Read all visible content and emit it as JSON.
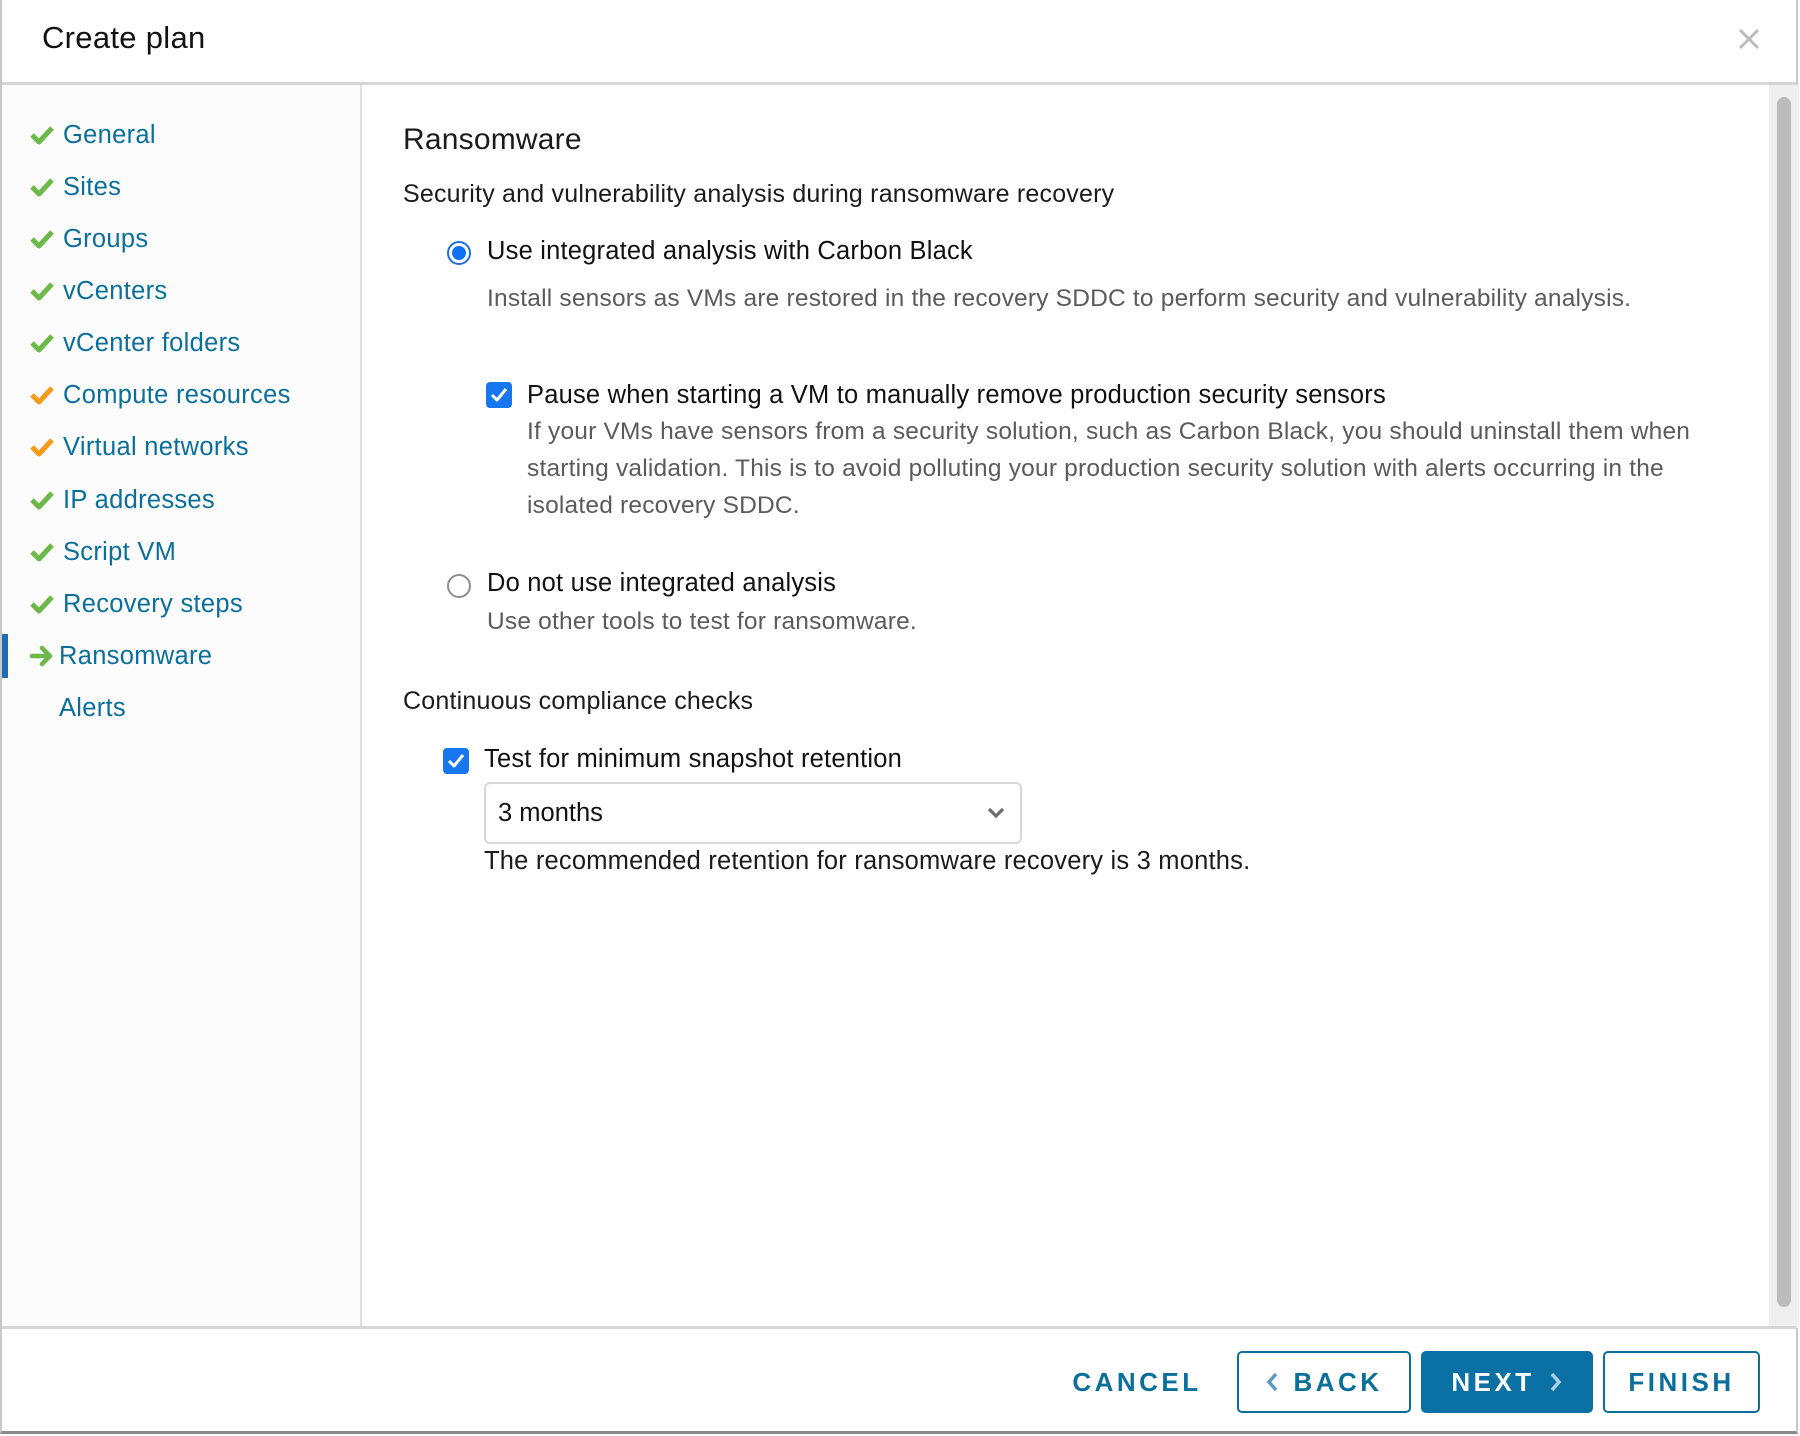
{
  "dialog": {
    "title": "Create plan",
    "close_icon": "close-icon"
  },
  "sidebar": {
    "items": [
      {
        "label": "General",
        "status": "complete",
        "icon": "check-icon",
        "color": "#6cb94a"
      },
      {
        "label": "Sites",
        "status": "complete",
        "icon": "check-icon",
        "color": "#6cb94a"
      },
      {
        "label": "Groups",
        "status": "complete",
        "icon": "check-icon",
        "color": "#6cb94a"
      },
      {
        "label": "vCenters",
        "status": "complete",
        "icon": "check-icon",
        "color": "#6cb94a"
      },
      {
        "label": "vCenter folders",
        "status": "complete",
        "icon": "check-icon",
        "color": "#6cb94a"
      },
      {
        "label": "Compute resources",
        "status": "warning",
        "icon": "check-icon",
        "color": "#f59a1b"
      },
      {
        "label": "Virtual networks",
        "status": "warning",
        "icon": "check-icon",
        "color": "#f59a1b"
      },
      {
        "label": "IP addresses",
        "status": "complete",
        "icon": "check-icon",
        "color": "#6cb94a"
      },
      {
        "label": "Script VM",
        "status": "complete",
        "icon": "check-icon",
        "color": "#6cb94a"
      },
      {
        "label": "Recovery steps",
        "status": "complete",
        "icon": "check-icon",
        "color": "#6cb94a"
      },
      {
        "label": "Ransomware",
        "status": "current",
        "icon": "arrow-right-icon",
        "color": "#6cb94a"
      },
      {
        "label": "Alerts",
        "status": "pending",
        "icon": "",
        "color": ""
      }
    ]
  },
  "main": {
    "heading": "Ransomware",
    "analysis_section": {
      "title": "Security and vulnerability analysis during ransomware recovery",
      "options": [
        {
          "label": "Use integrated analysis with Carbon Black",
          "selected": true,
          "description": "Install sensors as VMs are restored in the recovery SDDC to perform security and vulnerability analysis.",
          "sub_checkbox": {
            "label": "Pause when starting a VM to manually remove production security sensors",
            "checked": true,
            "description": "If your VMs have sensors from a security solution, such as Carbon Black, you should uninstall them when starting validation. This is to avoid polluting your production security solution with alerts occurring in the isolated recovery SDDC."
          }
        },
        {
          "label": "Do not use integrated analysis",
          "selected": false,
          "description": "Use other tools to test for ransomware."
        }
      ]
    },
    "compliance_section": {
      "title": "Continuous compliance checks",
      "checkbox": {
        "label": "Test for minimum snapshot retention",
        "checked": true
      },
      "retention_select": {
        "value": "3 months"
      },
      "note": "The recommended retention for ransomware recovery is 3 months."
    }
  },
  "footer": {
    "cancel_label": "CANCEL",
    "back_label": "BACK",
    "next_label": "NEXT",
    "finish_label": "FINISH"
  },
  "colors": {
    "link": "#0b6f9b",
    "primary": "#0b70a3",
    "complete": "#6cb94a",
    "warning": "#f59a1b",
    "active_bar": "#1b6eb6",
    "control_blue": "#1777ee"
  }
}
